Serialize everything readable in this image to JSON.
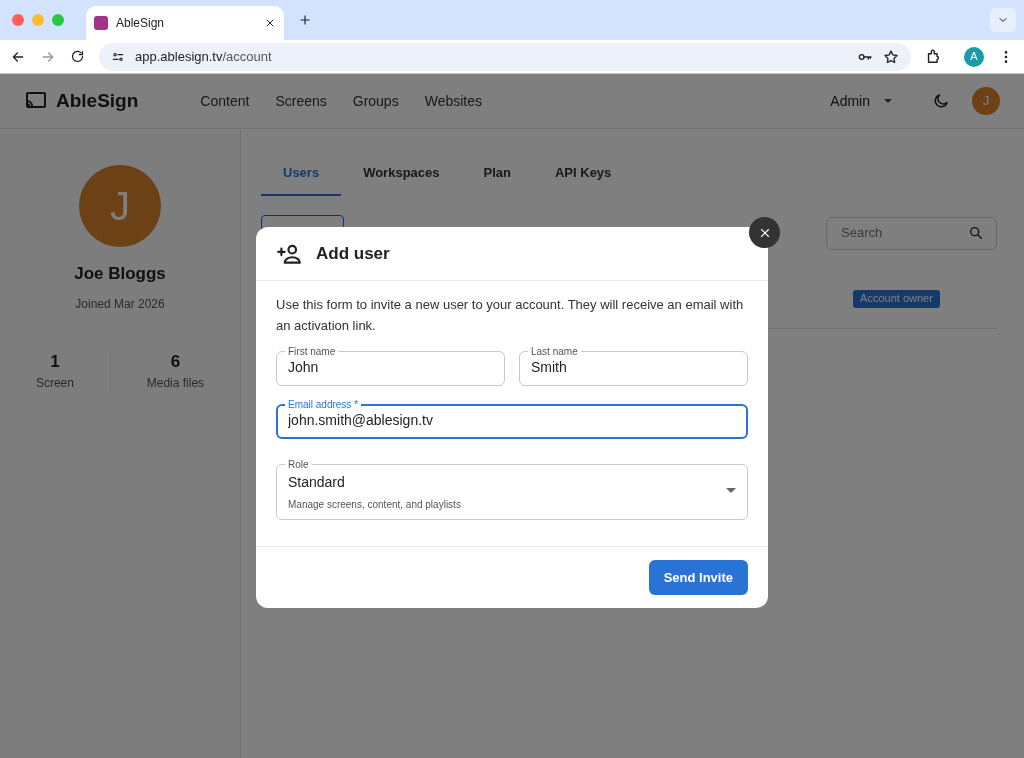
{
  "browser": {
    "tab_title": "AbleSign",
    "url_host": "app.ablesign.tv",
    "url_path": "/account",
    "profile_initial": "A"
  },
  "app_bar": {
    "brand": "AbleSign",
    "nav": [
      "Content",
      "Screens",
      "Groups",
      "Websites"
    ],
    "user_menu": "Admin",
    "avatar_initial": "J"
  },
  "profile": {
    "initial": "J",
    "name": "Joe Bloggs",
    "joined": "Joined Mar 2026",
    "stats": [
      {
        "value": "1",
        "label": "Screen"
      },
      {
        "value": "6",
        "label": "Media files"
      }
    ]
  },
  "tabs": [
    {
      "label": "Users",
      "selected": true
    },
    {
      "label": "Workspaces",
      "selected": false
    },
    {
      "label": "Plan",
      "selected": false
    },
    {
      "label": "API Keys",
      "selected": false
    }
  ],
  "users": {
    "search": {
      "placeholder": "Search"
    },
    "badge": "Account owner"
  },
  "modal": {
    "title": "Add user",
    "description": "Use this form to invite a new user to your account. They will receive an email with an activation link.",
    "fields": [
      {
        "label": "First name",
        "value": "John",
        "focused": false
      },
      {
        "label": "Last name",
        "value": "Smith",
        "focused": false
      },
      {
        "label": "Email address *",
        "value": "john.smith@ablesign.tv",
        "focused": true
      }
    ],
    "role": {
      "label": "Role",
      "value": "Standard",
      "hint": "Manage screens, content, and playlists"
    },
    "button": "Send Invite"
  }
}
